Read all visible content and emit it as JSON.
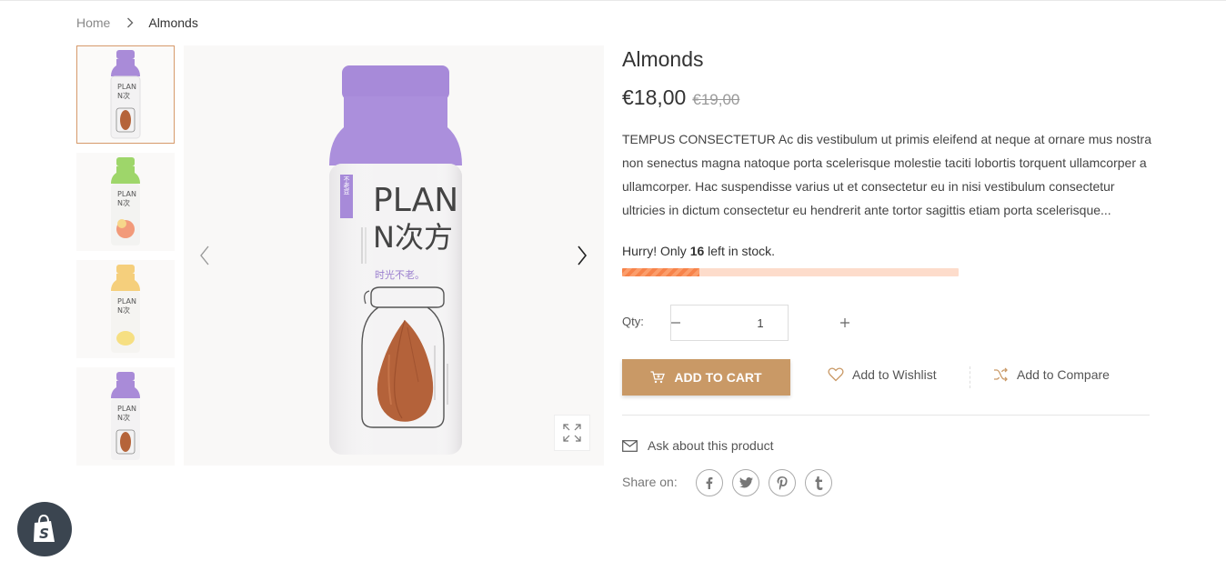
{
  "breadcrumb": {
    "home": "Home",
    "current": "Almonds"
  },
  "gallery": {
    "thumbnails": [
      {
        "label": "Almond bottle",
        "color": "#a98bd8"
      },
      {
        "label": "Peach bottle",
        "color": "#9ed66a"
      },
      {
        "label": "Lemon bottle",
        "color": "#f5cf7c"
      },
      {
        "label": "Almond bottle",
        "color": "#a98bd8"
      }
    ],
    "main_bottle": {
      "brand_line1": "PLAN",
      "brand_line2": "N次方",
      "side_tag": "不老豆",
      "tagline": "时光不老。"
    }
  },
  "product": {
    "title": "Almonds",
    "price": "€18,00",
    "compare_price": "€19,00",
    "description": "TEMPUS CONSECTETUR Ac dis vestibulum ut primis eleifend at neque at ornare mus nostra non senectus magna natoque porta scelerisque molestie taciti lobortis torquent ullamcorper a ullamcorper. Hac suspendisse varius ut et consectetur eu in nisi vestibulum consectetur ultricies in dictum consectetur eu hendrerit ante tortor sagittis etiam porta scelerisque...",
    "stock_prefix": "Hurry! Only",
    "stock_count": "16",
    "stock_suffix": "left in stock.",
    "stock_fill_fraction": 0.23,
    "qty_label": "Qty:",
    "qty_value": "1",
    "add_to_cart": "ADD TO CART",
    "add_to_wishlist": "Add to Wishlist",
    "add_to_compare": "Add to Compare",
    "ask": "Ask about this product",
    "share_label": "Share on:"
  },
  "colors": {
    "accent": "#c99966",
    "stock_bar_bg": "#fddccb",
    "stock_bar_fill": "#f7834a",
    "thumb_active_border": "#d69a6b"
  },
  "icons": {
    "breadcrumb_sep": "chevron-right-icon",
    "prev": "chevron-left-icon",
    "next": "chevron-right-icon",
    "zoom": "expand-icon",
    "cart": "cart-icon",
    "wishlist": "heart-icon",
    "compare": "shuffle-icon",
    "ask": "mail-icon",
    "socials": [
      "facebook-icon",
      "twitter-icon",
      "pinterest-icon",
      "tumblr-icon"
    ],
    "badge": "shopify-icon"
  }
}
